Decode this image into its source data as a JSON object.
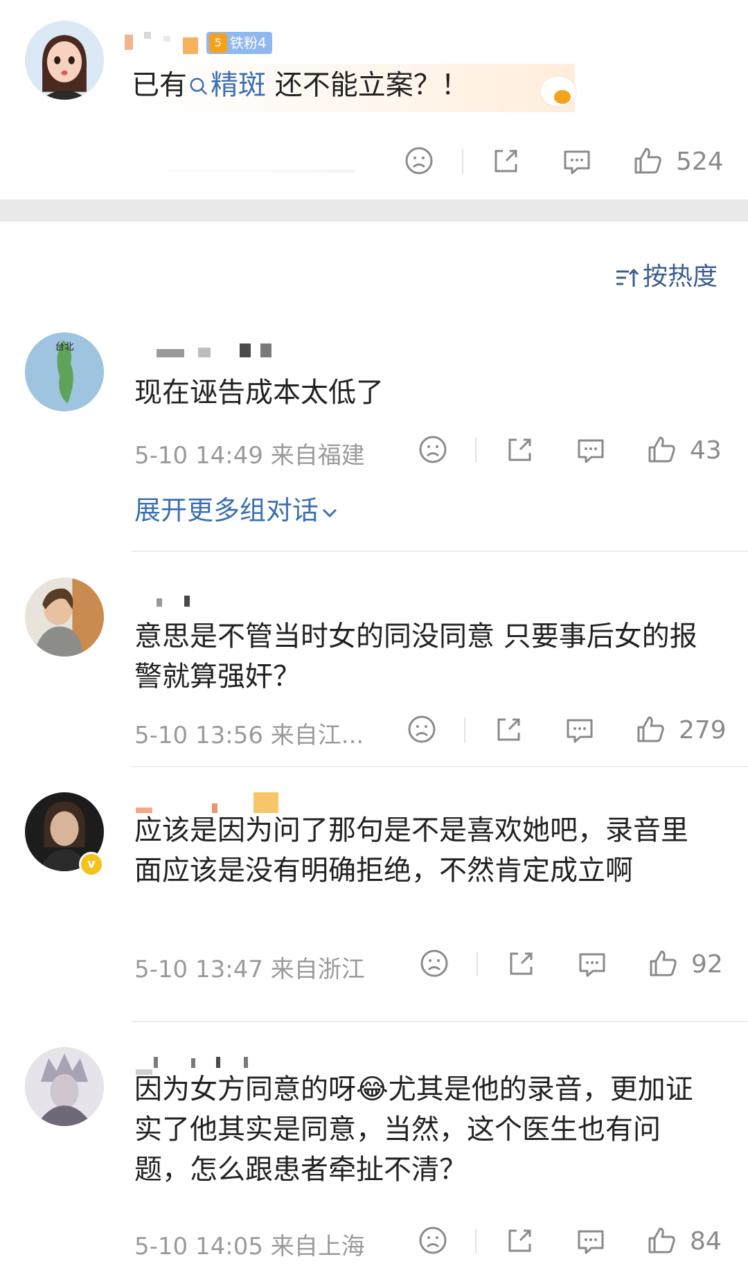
{
  "top_comment": {
    "badge": "铁粉4",
    "badge_level": "5",
    "text_before": "已有",
    "link_text": "精斑",
    "text_after": " 还不能立案？！",
    "likes": "524"
  },
  "sort": {
    "label": "按热度"
  },
  "comments": [
    {
      "text": "现在诬告成本太低了",
      "time": "5-10 14:49",
      "location": "来自福建",
      "likes": "43",
      "expand": "展开更多组对话"
    },
    {
      "text": "意思是不管当时女的同没同意 只要事后女的报警就算强奸？",
      "time": "5-10 13:56",
      "location": "来自江...",
      "likes": "279"
    },
    {
      "text": "应该是因为问了那句是不是喜欢她吧，录音里面应该是没有明确拒绝，不然肯定成立啊",
      "time": "5-10 13:47",
      "location": "来自浙江",
      "likes": "92"
    },
    {
      "text": "因为女方同意的呀😂尤其是他的录音，更加证实了他其实是同意，当然，这个医生也有问题，怎么跟患者牵扯不清？",
      "time": "5-10 14:05",
      "location": "来自上海",
      "likes": "84"
    }
  ],
  "colors": {
    "link": "#3b6fb5",
    "meta": "#9a9a9a",
    "badge": "#8fb8ef"
  }
}
